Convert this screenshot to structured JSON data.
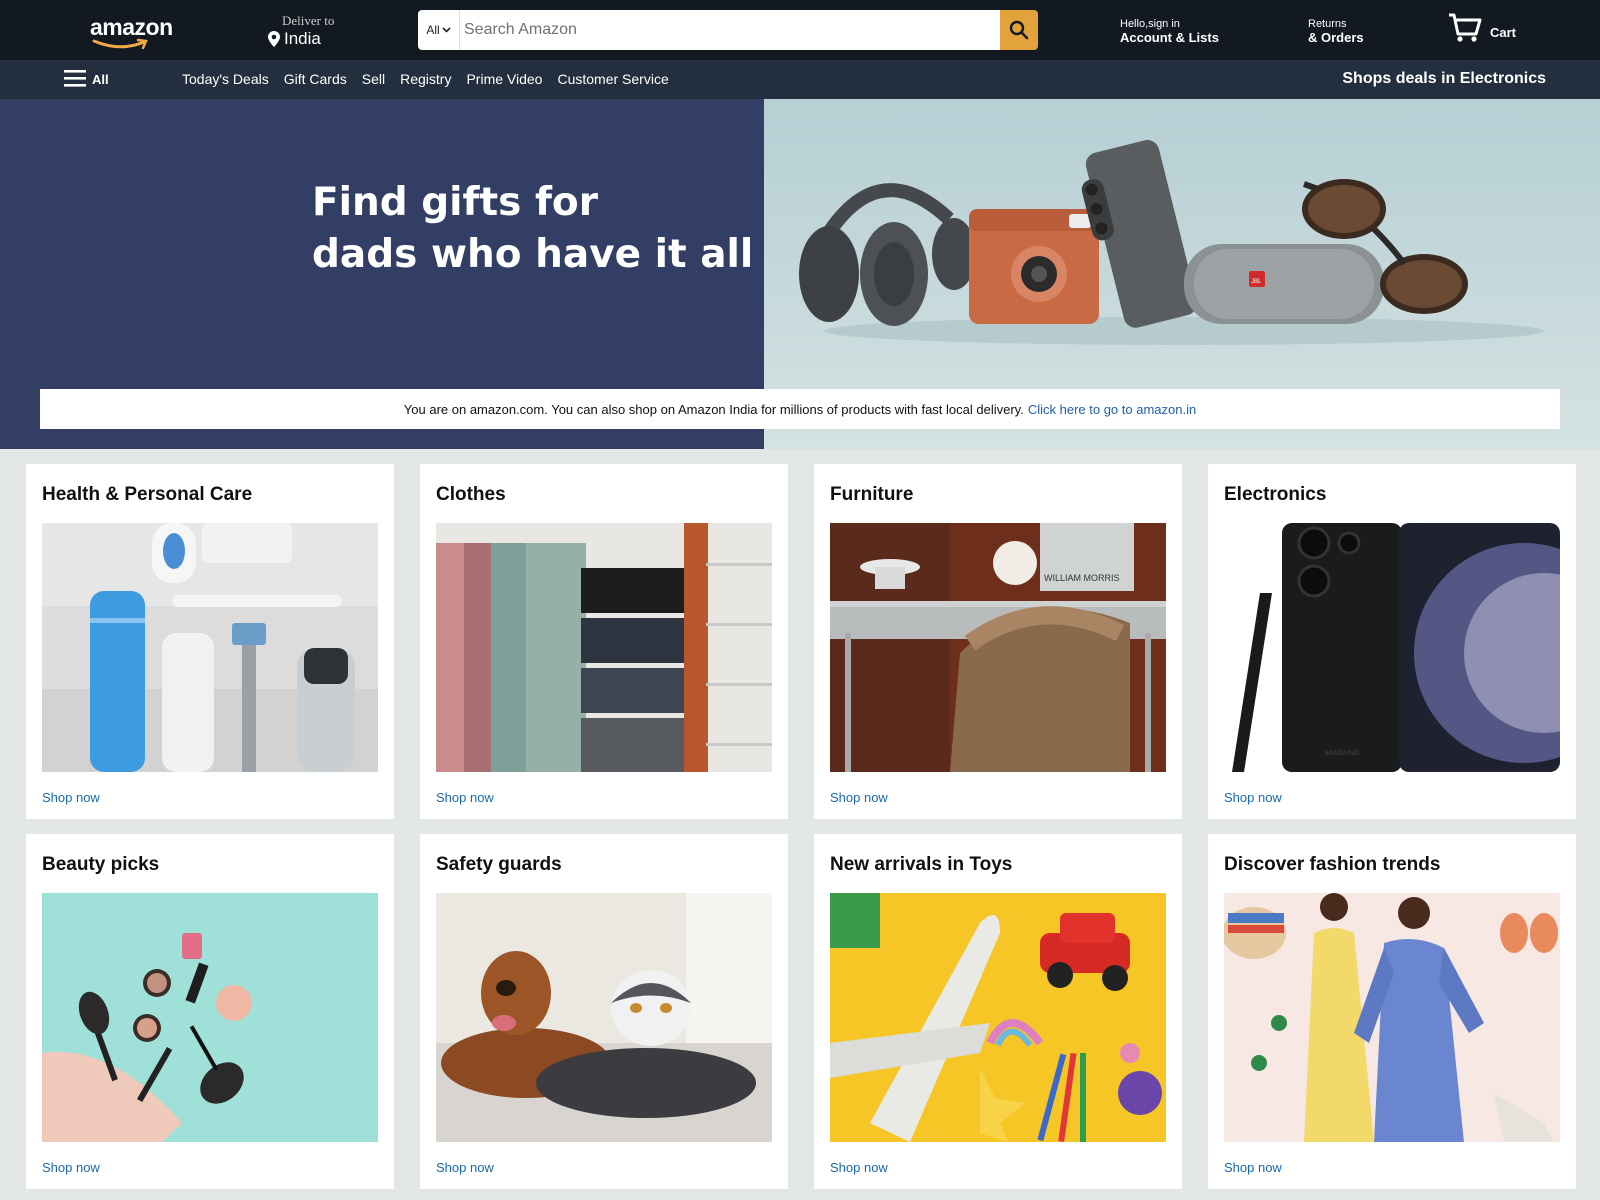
{
  "header": {
    "logo_text": "amazon",
    "deliver_label": "Deliver to",
    "deliver_location": "India",
    "search_category": "All",
    "search_placeholder": "Search Amazon",
    "account_greeting": "Hello,sign in",
    "account_label": "Account & Lists",
    "returns_label": "Returns",
    "orders_label": "& Orders",
    "cart_label": "Cart"
  },
  "nav": {
    "all_label": "All",
    "links": [
      "Today's Deals",
      "Gift Cards",
      "Sell",
      "Registry",
      "Prime Video",
      "Customer Service"
    ],
    "promo": "Shops deals in Electronics"
  },
  "hero": {
    "title_line1": "Find gifts for",
    "title_line2": "dads who have it all",
    "notice_text": "You are on amazon.com. You can also shop on Amazon India for millions of products with fast local delivery.",
    "notice_link": "Click here to go to amazon.in"
  },
  "cards": [
    {
      "title": "Health & Personal Care",
      "link": "Shop now"
    },
    {
      "title": "Clothes",
      "link": "Shop now"
    },
    {
      "title": "Furniture",
      "link": "Shop now"
    },
    {
      "title": "Electronics",
      "link": "Shop now"
    },
    {
      "title": "Beauty picks",
      "link": "Shop now"
    },
    {
      "title": "Safety guards",
      "link": "Shop now"
    },
    {
      "title": "New arrivals in Toys",
      "link": "Shop now"
    },
    {
      "title": "Discover fashion trends",
      "link": "Shop now"
    }
  ],
  "image_labels": {
    "furniture_print": "WILLIAM MORRIS",
    "phone_brand": "SAMSUNG",
    "speaker_brand": "JBL"
  },
  "colors": {
    "header_bg": "#131921",
    "nav_bg": "#232f3e",
    "search_button": "#e2a33b",
    "hero_left": "#323e64",
    "link": "#1a6aa5",
    "page_bg": "#e3e6e6"
  }
}
